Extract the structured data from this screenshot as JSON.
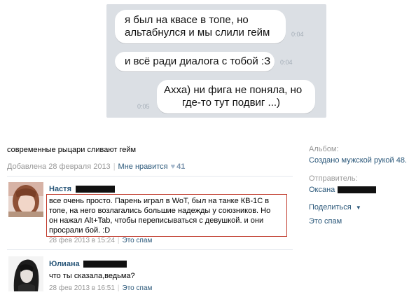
{
  "chat": {
    "messages": [
      {
        "lines": [
          "я был на квасе в топе, но",
          "альтабнулся и мы слили гейм"
        ],
        "time": "0:04"
      },
      {
        "lines": [
          "и всё ради диалога с тобой :З"
        ],
        "time": "0:04"
      },
      {
        "lines": [
          "Ахха) ни фига не поняла, но",
          "где-то тут подвиг ...)"
        ],
        "time": "0:05"
      }
    ]
  },
  "post": {
    "title": "современные рыцари сливают гейм",
    "added": "Добавлена 28 февраля 2013",
    "like_label": "Мне нравится",
    "like_count": "41"
  },
  "comments": [
    {
      "name": "Настя",
      "lines": [
        "все очень просто. Парень играл в WoT, был на танке КВ-1С в",
        "топе, на него возлагались большие надежды у союзников. Но",
        "он нажал Alt+Tab, чтобы переписываться с девушкой. и они",
        "просрали бой. :D"
      ],
      "date": "28 фев 2013 в 15:24",
      "spam": "Это спам"
    },
    {
      "name": "Юлиана",
      "lines": [
        "что ты сказала,ведьма?"
      ],
      "date": "28 фев 2013 в 16:51",
      "spam": "Это спам"
    }
  ],
  "sidebar": {
    "album_label": "Альбом:",
    "album_value": "Создано мужской рукой 48.",
    "sender_label": "Отправитель:",
    "sender_name": "Оксана",
    "share": "Поделиться",
    "spam": "Это спам"
  }
}
